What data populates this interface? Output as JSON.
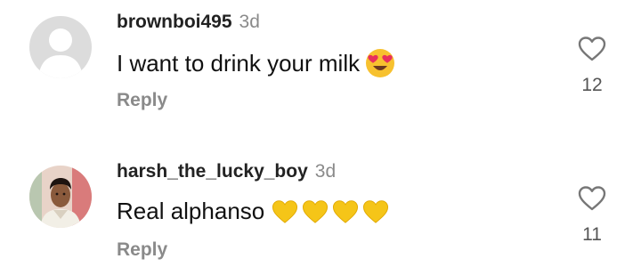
{
  "comments": [
    {
      "username": "brownboi495",
      "time": "3d",
      "text": "I want to drink your milk",
      "emojis": [
        "heart-eyes-emoji"
      ],
      "reply_label": "Reply",
      "likes": "12",
      "avatar": "default-avatar"
    },
    {
      "username": "harsh_the_lucky_boy",
      "time": "3d",
      "text": "Real alphanso",
      "emojis": [
        "yellow-heart-emoji",
        "yellow-heart-emoji",
        "yellow-heart-emoji",
        "yellow-heart-emoji"
      ],
      "reply_label": "Reply",
      "likes": "11",
      "avatar": "user-photo-avatar"
    }
  ],
  "colors": {
    "username": "#222222",
    "muted": "#8a8a8a",
    "heart_outline": "#777777",
    "yellow_heart": "#f5c518"
  }
}
